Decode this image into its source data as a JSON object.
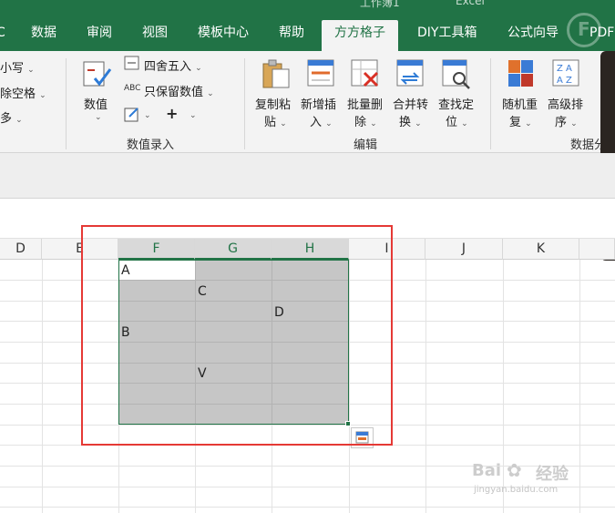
{
  "window": {
    "title_fragment": "工作簿1",
    "app_fragment": "Excel"
  },
  "tabs": [
    {
      "label": "C"
    },
    {
      "label": "数据"
    },
    {
      "label": "审阅"
    },
    {
      "label": "视图"
    },
    {
      "label": "模板中心"
    },
    {
      "label": "帮助"
    },
    {
      "label": "方方格子",
      "active": true
    },
    {
      "label": "DIY工具箱"
    },
    {
      "label": "公式向导"
    },
    {
      "label": "PDF"
    }
  ],
  "ribbon": {
    "left_partial": [
      "小写",
      "除空格",
      "多"
    ],
    "value_group": {
      "big_button": "数值",
      "round": "四舍五入",
      "keep_values": "只保留数值",
      "label": "数值录入"
    },
    "edit_group": {
      "label": "编辑",
      "buttons": [
        {
          "line1": "复制粘",
          "line2": "贴"
        },
        {
          "line1": "新增插",
          "line2": "入"
        },
        {
          "line1": "批量删",
          "line2": "除"
        },
        {
          "line1": "合并转",
          "line2": "换"
        },
        {
          "line1": "查找定",
          "line2": "位"
        }
      ]
    },
    "data_group": {
      "label": "数据分",
      "buttons": [
        {
          "line1": "随机重",
          "line2": "复"
        },
        {
          "line1": "高级排",
          "line2": "序"
        }
      ]
    }
  },
  "columns": [
    "D",
    "E",
    "F",
    "G",
    "H",
    "I",
    "J",
    "K"
  ],
  "cells": [
    "A",
    "C",
    "D",
    "B",
    "V"
  ],
  "watermark": {
    "brand": "Bai",
    "brand2": "经验",
    "url": "jingyan.baidu.com"
  },
  "colors": {
    "excel_green": "#217346",
    "selection_gray": "#c6c6c6",
    "highlight_red": "#e53935"
  }
}
